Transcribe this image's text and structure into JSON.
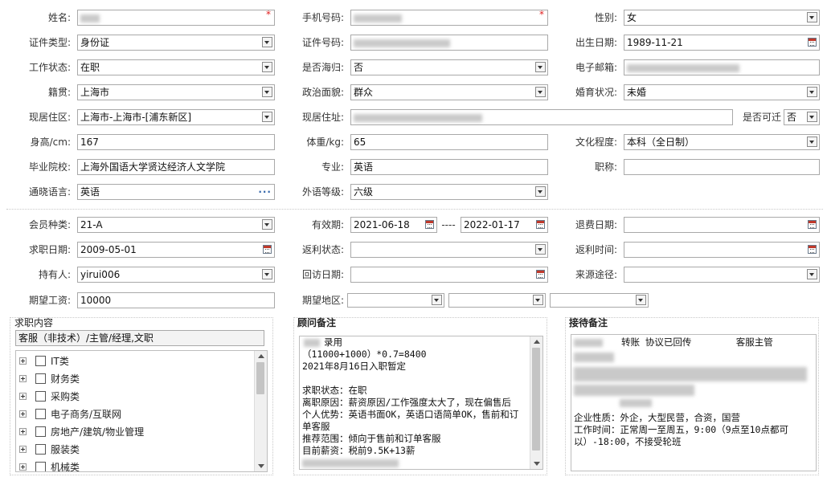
{
  "labels": {
    "name": "姓名:",
    "phone": "手机号码:",
    "gender": "性别:",
    "id_type": "证件类型:",
    "id_no": "证件号码:",
    "birth": "出生日期:",
    "work_status": "工作状态:",
    "overseas": "是否海归:",
    "email": "电子邮箱:",
    "native": "籍贯:",
    "political": "政治面貌:",
    "marital": "婚育状况:",
    "cur_area": "现居住区:",
    "cur_addr": "现居住址:",
    "relocate": "是否可迁",
    "height": "身高/cm:",
    "weight": "体重/kg:",
    "education": "文化程度:",
    "school": "毕业院校:",
    "major": "专业:",
    "title": "职称:",
    "language": "通晓语言:",
    "lang_level": "外语等级:",
    "member_type": "会员种类:",
    "valid": "有效期:",
    "refund_date": "退费日期:",
    "apply_date": "求职日期:",
    "rebate_status": "返利状态:",
    "rebate_time": "返利时间:",
    "holder": "持有人:",
    "visit_date": "回访日期:",
    "source": "来源途径:",
    "salary": "期望工资:",
    "region": "期望地区:"
  },
  "values": {
    "gender": "女",
    "id_type": "身份证",
    "birth": "1989-11-21",
    "work_status": "在职",
    "overseas": "否",
    "native": "上海市",
    "political": "群众",
    "marital": "未婚",
    "cur_area": "上海市-上海市-[浦东新区]",
    "relocate": "否",
    "height": "167",
    "weight": "65",
    "education": "本科（全日制）",
    "school": "上海外国语大学贤达经济人文学院",
    "major": "英语",
    "title": "",
    "language": "英语",
    "lang_level": "六级",
    "member_type": "21-A",
    "valid_from": "2021-06-18",
    "valid_sep": "----",
    "valid_to": "2022-01-17",
    "refund_date": "",
    "apply_date": "2009-05-01",
    "rebate_status": "",
    "rebate_time": "",
    "holder": "yirui006",
    "visit_date": "",
    "source": "",
    "salary": "10000"
  },
  "required_mark": "*",
  "job_panel": {
    "title": "求职内容",
    "selected": "客服（非技术）/主管/经理,文职",
    "items": [
      "IT类",
      "财务类",
      "采购类",
      "电子商务/互联网",
      "房地产/建筑/物业管理",
      "服装类",
      "机械类"
    ]
  },
  "advisor_panel": {
    "title": "顾问备注",
    "lines": [
      "录用",
      "（11000+1000）*0.7=8400",
      "2021年8月16日入职暂定",
      "",
      "求职状态：在职",
      "离职原因：薪资原因/工作强度太大了，现在偏售后",
      "个人优势：英语书面OK，英语口语简单OK，售前和订",
      "单客服",
      "推荐范围：倾向于售前和订单客服",
      "目前薪资：税前9.5K+13薪"
    ]
  },
  "reception_panel": {
    "title": "接待备注",
    "line1": "转账 协议已回传        客服主管",
    "lines": [
      "企业性质：外企，大型民营，合资，国营",
      "工作时间：正常周一至周五，9:00（9点至10点都可",
      "以）-18:00，不接受轮班"
    ]
  },
  "icons": {
    "dropdown": "chevron-down-icon",
    "calendar": "calendar-icon",
    "more": "ellipsis-icon",
    "expand": "plus-icon"
  },
  "colors": {
    "required": "#e02020",
    "border": "#a9a9a9",
    "calendar_accent": "#c0392b"
  }
}
